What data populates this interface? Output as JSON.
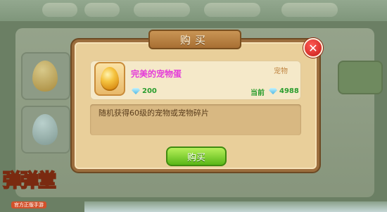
{
  "dialog": {
    "title": "购买",
    "close_symbol": "✕",
    "buy_button_label": "购买"
  },
  "item": {
    "name": "完美的宠物蛋",
    "type": "宠物",
    "price": "200",
    "current_label": "当前",
    "current_amount": "4988",
    "description": "随机获得60级的宠物或宠物碎片",
    "icon": "golden-egg-icon",
    "currency_icon": "diamond-icon"
  },
  "logo": {
    "title": "弹弹堂",
    "subtitle": "官方正版手游"
  },
  "colors": {
    "item_name": "#e43bd9",
    "price_green": "#2a9d2e",
    "dialog_bg": "#e9cf9a",
    "buy_button": "#59b617",
    "close_button": "#c51a16"
  }
}
